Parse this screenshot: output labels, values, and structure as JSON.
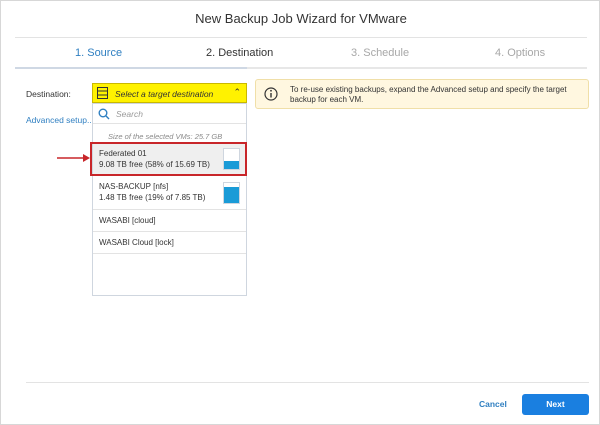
{
  "window": {
    "title": "New Backup Job Wizard for VMware"
  },
  "steps": [
    {
      "label": "1. Source"
    },
    {
      "label": "2. Destination"
    },
    {
      "label": "3. Schedule"
    },
    {
      "label": "4. Options"
    }
  ],
  "destination": {
    "label": "Destination:",
    "advanced_link": "Advanced setup...",
    "select_placeholder": "Select a target destination",
    "search_placeholder": "Search",
    "size_label": "Size of the selected VMs:",
    "size_value": "25.7 GB",
    "options": [
      {
        "name": "Federated 01",
        "free": "9.08 TB free (58% of 15.69 TB)",
        "used_fraction": 0.42,
        "selected": true
      },
      {
        "name": "NAS-BACKUP [nfs]",
        "free": "1.48 TB free (19% of 7.85 TB)",
        "used_fraction": 0.81
      },
      {
        "name": "WASABI [cloud]"
      },
      {
        "name": "WASABI Cloud [lock]"
      }
    ]
  },
  "info": {
    "text": "To re-use existing backups, expand the Advanced setup and specify the target backup for each VM."
  },
  "footer": {
    "cancel_label": "Cancel",
    "next_label": "Next"
  },
  "colors": {
    "accent": "#1a7fe0",
    "select_highlight": "#fff200",
    "callout": "#c8262a",
    "storage_bar": "#1a9bd7"
  }
}
